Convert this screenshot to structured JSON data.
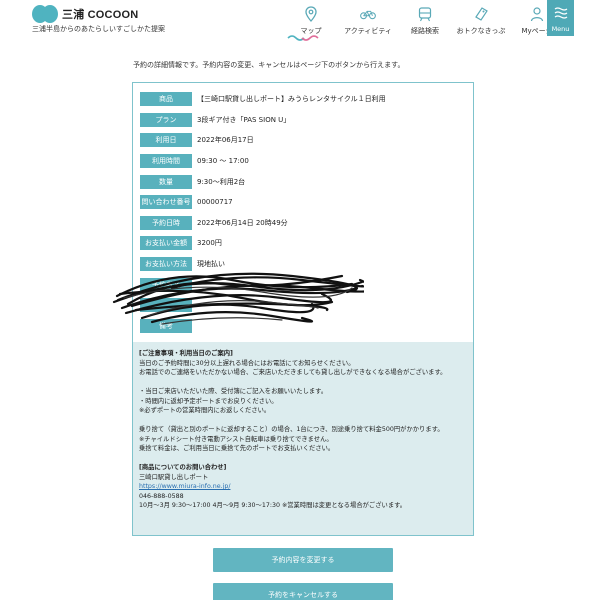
{
  "header": {
    "logo_text": "三浦 COCOON",
    "tagline": "三浦半島からのあたらしいすごしかた提案",
    "nav": [
      {
        "label": "マップ",
        "icon": "map-pin-icon"
      },
      {
        "label": "アクティビティ",
        "icon": "bicycle-icon"
      },
      {
        "label": "経路検索",
        "icon": "train-icon"
      },
      {
        "label": "おトクなきっぷ",
        "icon": "ticket-icon"
      },
      {
        "label": "Myページ",
        "icon": "user-icon"
      }
    ],
    "menu_label": "Menu",
    "accent_color": "#4fa9b6"
  },
  "intro": "予約の詳細情報です。予約内容の変更、キャンセルはページ下のボタンから行えます。",
  "details": [
    {
      "key": "商品",
      "value": "【三崎口駅貸し出しポート】みうらレンタサイクル１日利用"
    },
    {
      "key": "プラン",
      "value": "3段ギア付き「PAS SION U」"
    },
    {
      "key": "利用日",
      "value": "2022年06月17日"
    },
    {
      "key": "利用時間",
      "value": "09:30 ～ 17:00"
    },
    {
      "key": "数量",
      "value": "9:30～利用2台"
    },
    {
      "key": "問い合わせ番号",
      "value": "00000717"
    },
    {
      "key": "予約日時",
      "value": "2022年06月14日 20時49分"
    },
    {
      "key": "お支払い金額",
      "value": "3200円"
    },
    {
      "key": "お支払い方法",
      "value": "現地払い"
    },
    {
      "key": "予約者名",
      "value": ""
    },
    {
      "key": "",
      "value": ""
    },
    {
      "key": "備考",
      "value": ""
    }
  ],
  "notes": {
    "heading1": "[ご注意事項・利用当日のご案内]",
    "lines1": [
      "当日のご予約時間に30分以上遅れる場合にはお電話にてお知らせください。",
      "お電話でのご連絡をいただかない場合、ご来店いただきましても貸し出しができなくなる場合がございます。"
    ],
    "lines2": [
      "・当日ご来店いただいた際、受付簿にご記入をお願いいたします。",
      "・時間内に返却予定ポートまでお戻りください。",
      "※必ずポートの営業時間内にお返しください。"
    ],
    "lines3": [
      "乗り捨て（貸出と別のポートに返却すること）の場合、1台につき、別途乗り捨て料金500円がかかります。",
      "※チャイルドシート付き電動アシスト自転車は乗り捨てできません。",
      "乗捨て料金は、ご利用当日に乗捨て先のポートでお支払いください。"
    ],
    "heading2": "[商品についてのお問い合わせ]",
    "contact_name": "三崎口駅貸し出しポート",
    "contact_url": "https://www.miura-info.ne.jp/",
    "contact_phone": "046-888-0588",
    "contact_hours": "10月～3月 9:30～17:00 4月～9月 9:30～17:30 ※営業時間は変更となる場合がございます。"
  },
  "buttons": {
    "change": "予約内容を変更する",
    "cancel": "予約をキャンセルする"
  }
}
